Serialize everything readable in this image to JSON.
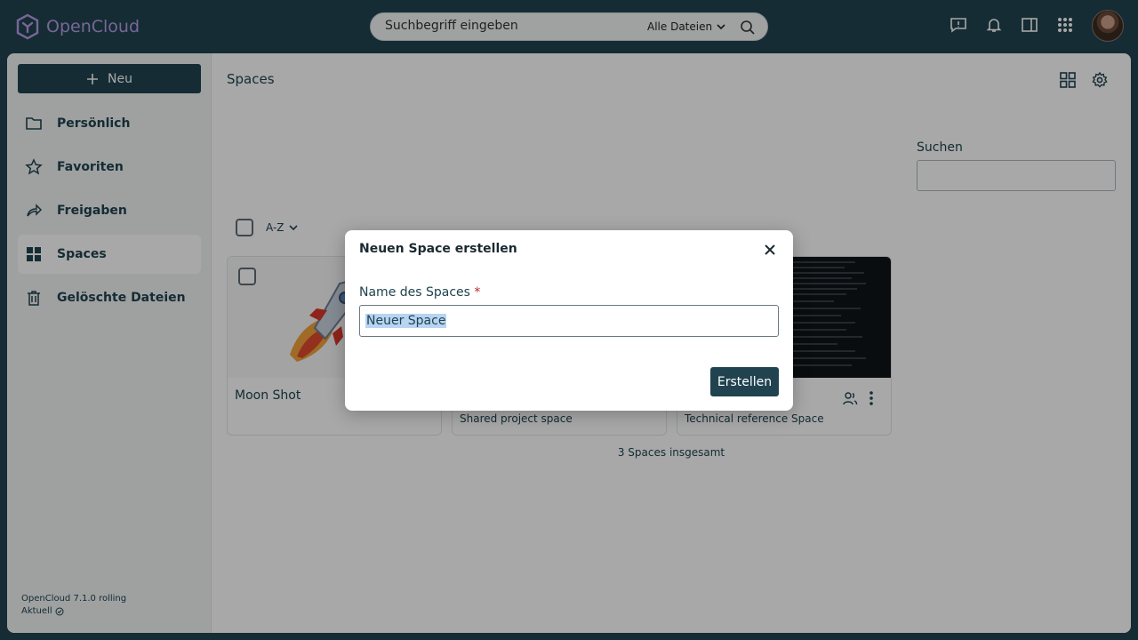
{
  "topbar": {
    "logo_text": "OpenCloud",
    "search_placeholder": "Suchbegriff eingeben",
    "search_scope": "Alle Dateien"
  },
  "sidebar": {
    "new_label": "Neu",
    "items": [
      {
        "label": "Persönlich",
        "icon": "folder-icon"
      },
      {
        "label": "Favoriten",
        "icon": "star-icon"
      },
      {
        "label": "Freigaben",
        "icon": "share-icon"
      },
      {
        "label": "Spaces",
        "icon": "grid-icon"
      },
      {
        "label": "Gelöschte Dateien",
        "icon": "trash-icon"
      }
    ],
    "version": "OpenCloud 7.1.0 rolling",
    "status": "Aktuell"
  },
  "main": {
    "title": "Spaces",
    "search_label": "Suchen",
    "sort_label": "A-Z",
    "cards": [
      {
        "title": "Moon Shot",
        "description": ""
      },
      {
        "title": "",
        "description": "Shared project space"
      },
      {
        "title": "",
        "description": "Technical reference Space"
      }
    ],
    "count_text": "3 Spaces insgesamt"
  },
  "modal": {
    "title": "Neuen Space erstellen",
    "field_label": "Name des Spaces",
    "required_mark": "*",
    "field_value": "Neuer Space",
    "submit_label": "Erstellen"
  },
  "colors": {
    "brand": "#20434f",
    "logo": "#b79de6",
    "required": "#c0262e"
  }
}
